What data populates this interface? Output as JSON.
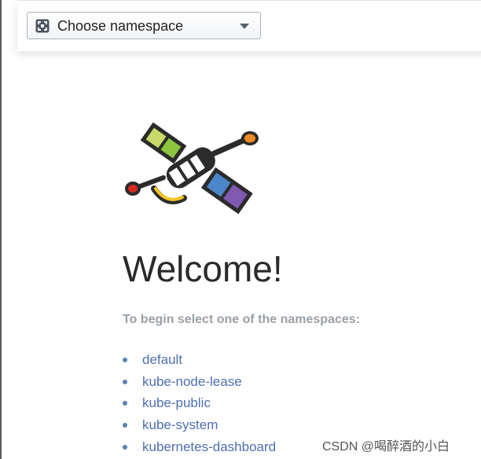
{
  "namespace_selector": {
    "label": "Choose namespace"
  },
  "welcome": {
    "title": "Welcome!",
    "intro": "To begin select one of the namespaces:"
  },
  "namespaces": [
    {
      "label": "default"
    },
    {
      "label": "kube-node-lease"
    },
    {
      "label": "kube-public"
    },
    {
      "label": "kube-system"
    },
    {
      "label": "kubernetes-dashboard"
    }
  ],
  "watermark": "CSDN @喝醉酒的小白",
  "colors": {
    "link": "#4f6fb0",
    "heading": "#2a2a2a",
    "muted": "#9aa0a6"
  },
  "icons": {
    "namespace_icon": "namespace-icon",
    "caret": "chevron-down-icon",
    "logo": "satellite-logo"
  }
}
